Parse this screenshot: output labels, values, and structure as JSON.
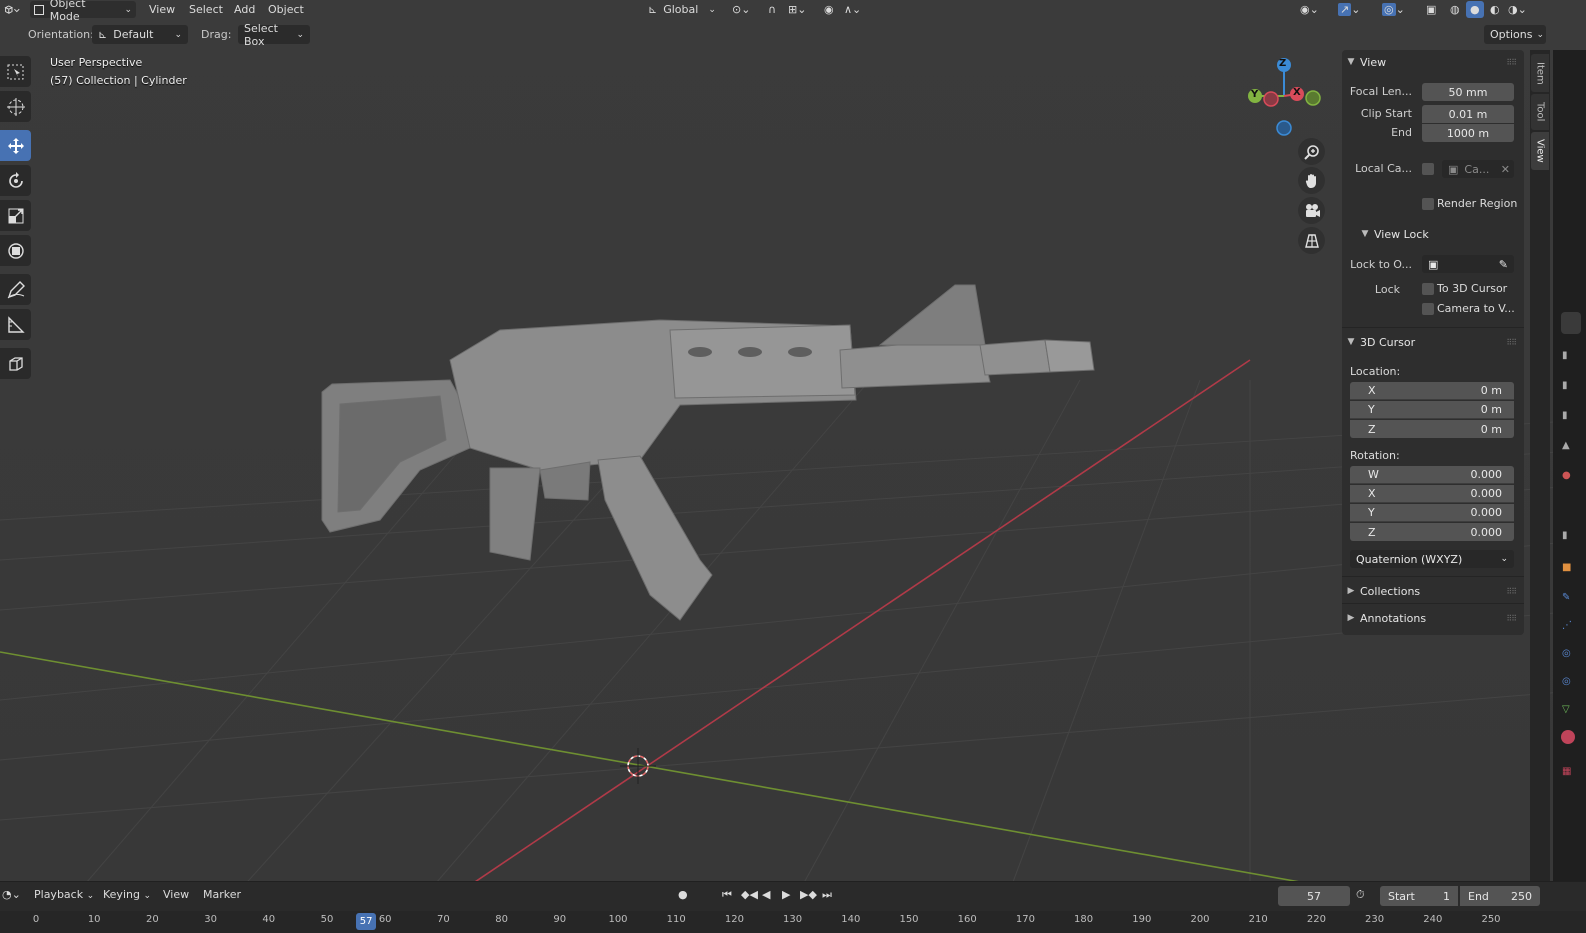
{
  "header": {
    "editor_icon": "3d-viewport-icon",
    "mode": "Object Mode",
    "menus": [
      "View",
      "Select",
      "Add",
      "Object"
    ],
    "transform_orientation": "Global"
  },
  "tool_options": {
    "orientation_label": "Orientation:",
    "orientation_value": "Default",
    "drag_label": "Drag:",
    "drag_value": "Select Box",
    "options_label": "Options"
  },
  "viewport": {
    "perspective_label": "User Perspective",
    "collection_label": "(57) Collection | Cylinder",
    "gizmo_axes": [
      "Z",
      "Y",
      "X"
    ]
  },
  "npanel": {
    "view": {
      "title": "View",
      "focal_label": "Focal Len...",
      "focal_value": "50 mm",
      "clip_start_label": "Clip Start",
      "clip_start_value": "0.01 m",
      "clip_end_label": "End",
      "clip_end_value": "1000 m",
      "local_camera_label": "Local Ca...",
      "local_camera_value": "Ca...",
      "render_region_label": "Render Region"
    },
    "view_lock": {
      "title": "View Lock",
      "lock_to_label": "Lock to O...",
      "lock_label": "Lock",
      "to_cursor_label": "To 3D Cursor",
      "camera_to_view_label": "Camera to V..."
    },
    "cursor": {
      "title": "3D Cursor",
      "location_label": "Location:",
      "location": [
        {
          "axis": "X",
          "value": "0 m"
        },
        {
          "axis": "Y",
          "value": "0 m"
        },
        {
          "axis": "Z",
          "value": "0 m"
        }
      ],
      "rotation_label": "Rotation:",
      "rotation": [
        {
          "axis": "W",
          "value": "0.000"
        },
        {
          "axis": "X",
          "value": "0.000"
        },
        {
          "axis": "Y",
          "value": "0.000"
        },
        {
          "axis": "Z",
          "value": "0.000"
        }
      ],
      "rotation_mode": "Quaternion (WXYZ)"
    },
    "collections_title": "Collections",
    "annotations_title": "Annotations",
    "tabs": [
      "Item",
      "Tool",
      "View"
    ]
  },
  "timeline": {
    "menus": [
      "Playback",
      "Keying",
      "View",
      "Marker"
    ],
    "current_frame": "57",
    "start_label": "Start",
    "start_value": "1",
    "end_label": "End",
    "end_value": "250",
    "ruler_ticks": [
      "0",
      "10",
      "20",
      "30",
      "40",
      "50",
      "60",
      "70",
      "80",
      "90",
      "100",
      "110",
      "120",
      "130",
      "140",
      "150",
      "160",
      "170",
      "180",
      "190",
      "200",
      "210",
      "220",
      "230",
      "240",
      "250"
    ]
  },
  "colors": {
    "accent": "#4772b3",
    "axis_x": "#d94b5a",
    "axis_y": "#82b441",
    "axis_z": "#3b8bd6"
  }
}
